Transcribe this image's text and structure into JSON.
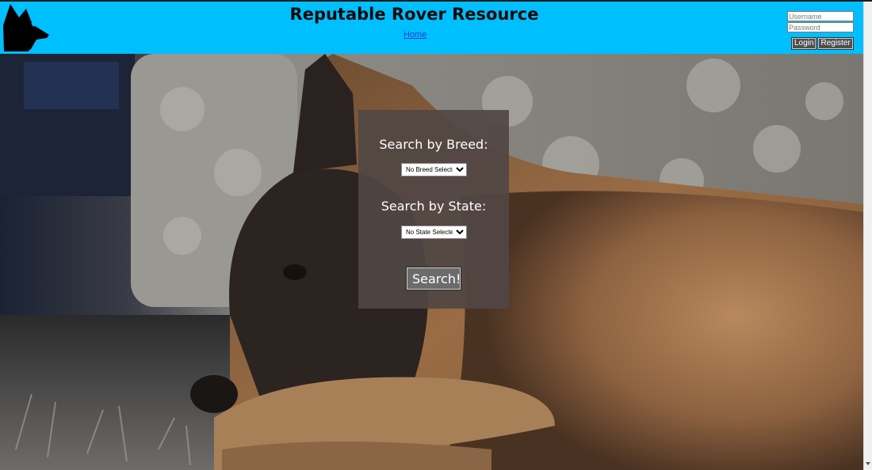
{
  "header": {
    "title": "Reputable Rover Resource",
    "home_link": "Home",
    "background": "#00bfff"
  },
  "login": {
    "username_placeholder": "Username",
    "password_placeholder": "Password",
    "login_label": "Login",
    "register_label": "Register"
  },
  "search_panel": {
    "breed_heading": "Search by Breed:",
    "breed_selected": "No Breed Selected",
    "state_heading": "Search by State:",
    "state_selected": "No State Selected",
    "search_label": "Search!"
  },
  "icons": {
    "logo": "dog-head-silhouette-icon"
  }
}
